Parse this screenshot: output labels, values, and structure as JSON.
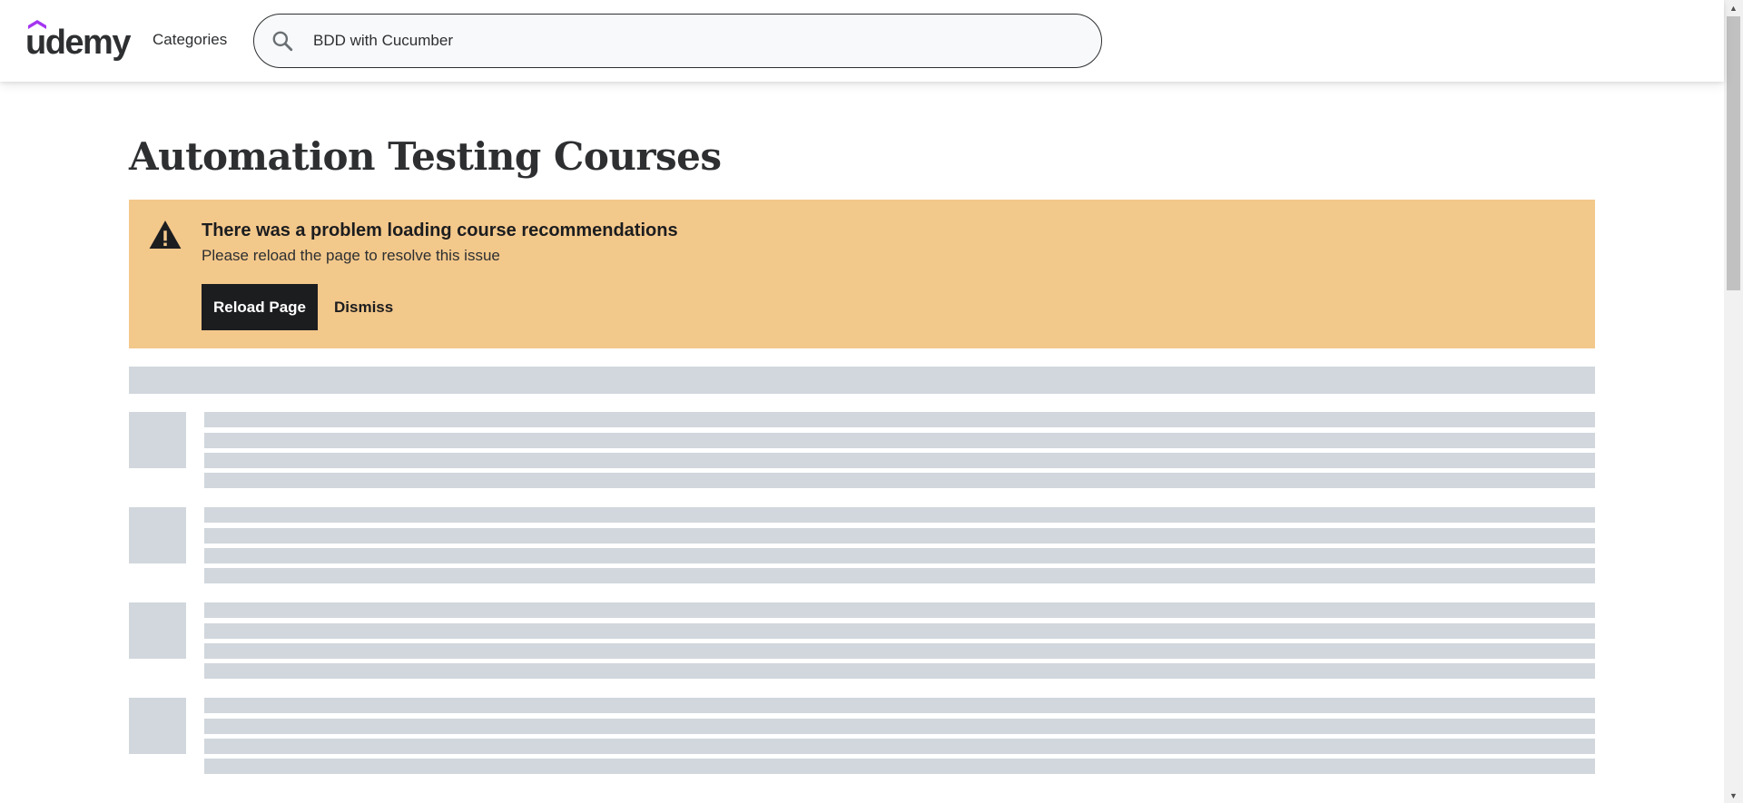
{
  "header": {
    "logo_text": "udemy",
    "categories_label": "Categories",
    "search": {
      "value": "BDD with Cucumber",
      "icon": "search-icon"
    }
  },
  "main": {
    "page_title": "Automation Testing Courses",
    "alert": {
      "icon": "warning-icon",
      "title": "There was a problem loading course recommendations",
      "message": "Please reload the page to resolve this issue",
      "reload_label": "Reload Page",
      "dismiss_label": "Dismiss"
    }
  },
  "colors": {
    "brand_accent": "#a435f0",
    "alert_background": "#f3c88b",
    "skeleton": "#d1d7dc",
    "text_dark": "#2d2f31"
  }
}
